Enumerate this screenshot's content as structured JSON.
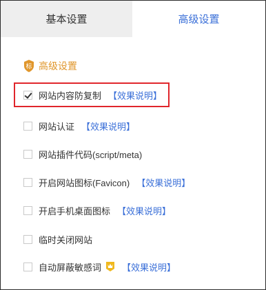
{
  "tabs": [
    {
      "label": "基本设置",
      "active": false
    },
    {
      "label": "高级设置",
      "active": true
    }
  ],
  "section": {
    "title": "高级设置",
    "icon": "shield-icon",
    "accent": "#e0962b"
  },
  "items": [
    {
      "label": "网站内容防复制",
      "checked": true,
      "link": "【效果说明】"
    },
    {
      "label": "网站认证",
      "checked": false,
      "link": "【效果说明】"
    },
    {
      "label": "网站插件代码(script/meta)",
      "checked": false
    },
    {
      "label": "开启网站图标(Favicon)",
      "checked": false,
      "link": "【效果说明】"
    },
    {
      "label": "开启手机桌面图标",
      "checked": false,
      "link": "【效果说明】"
    },
    {
      "label": "临时关闭网站",
      "checked": false
    },
    {
      "label": "自动屏蔽敏感词",
      "checked": false,
      "badge": "vip-crown-icon",
      "link": "【效果说明】"
    }
  ],
  "colors": {
    "link": "#3a6fd8",
    "highlight": "#e0252b",
    "tab_inactive_bg": "#eeeeee"
  }
}
